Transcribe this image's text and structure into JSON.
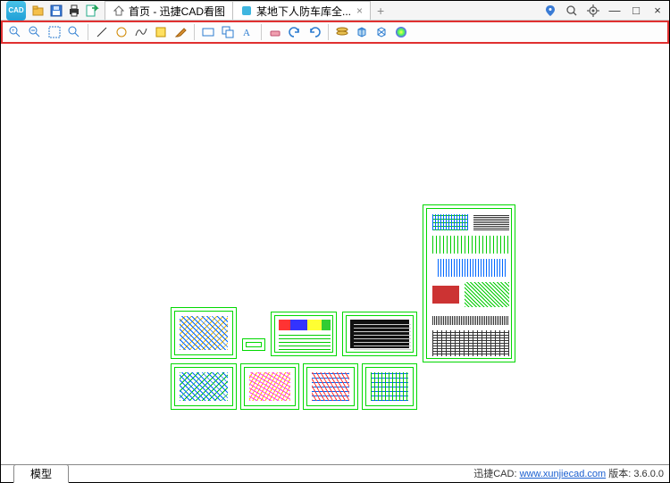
{
  "app": {
    "logo_text": "CAD"
  },
  "quick_access": {
    "open": "folder-open-icon",
    "save": "save-icon",
    "print": "print-icon",
    "export": "export-icon"
  },
  "tabs": {
    "home": {
      "label": "首页 - 迅捷CAD看图",
      "icon": "home-icon"
    },
    "file": {
      "label": "某地下人防车库全...",
      "icon": "doc-icon",
      "close": "×"
    },
    "new": "+"
  },
  "window_controls": {
    "locate": "map-pin-icon",
    "zoom": "zoom-icon",
    "settings": "gear-icon",
    "min": "—",
    "max": "□",
    "close": "×"
  },
  "toolbar": {
    "zoom_window": "zoom-window-icon",
    "zoom_out": "zoom-out-icon",
    "zoom_extents": "zoom-extents-icon",
    "pan": "pan-icon",
    "line": "line-icon",
    "circle": "circle-icon",
    "spline": "spline-icon",
    "highlight": "highlight-icon",
    "brush": "brush-icon",
    "rect": "rect-icon",
    "copy": "copy-icon",
    "text": "text-icon",
    "erase": "erase-icon",
    "undo": "undo-icon",
    "redo": "redo-icon",
    "layer": "layer-icon",
    "box3d": "box3d-icon",
    "wire3d": "wire3d-icon",
    "color": "color-icon"
  },
  "bottom": {
    "model_tab": "模型"
  },
  "footer": {
    "brand": "迅捷CAD:",
    "url": "www.xunjiecad.com",
    "version_label": "版本:",
    "version": "3.6.0.0"
  }
}
